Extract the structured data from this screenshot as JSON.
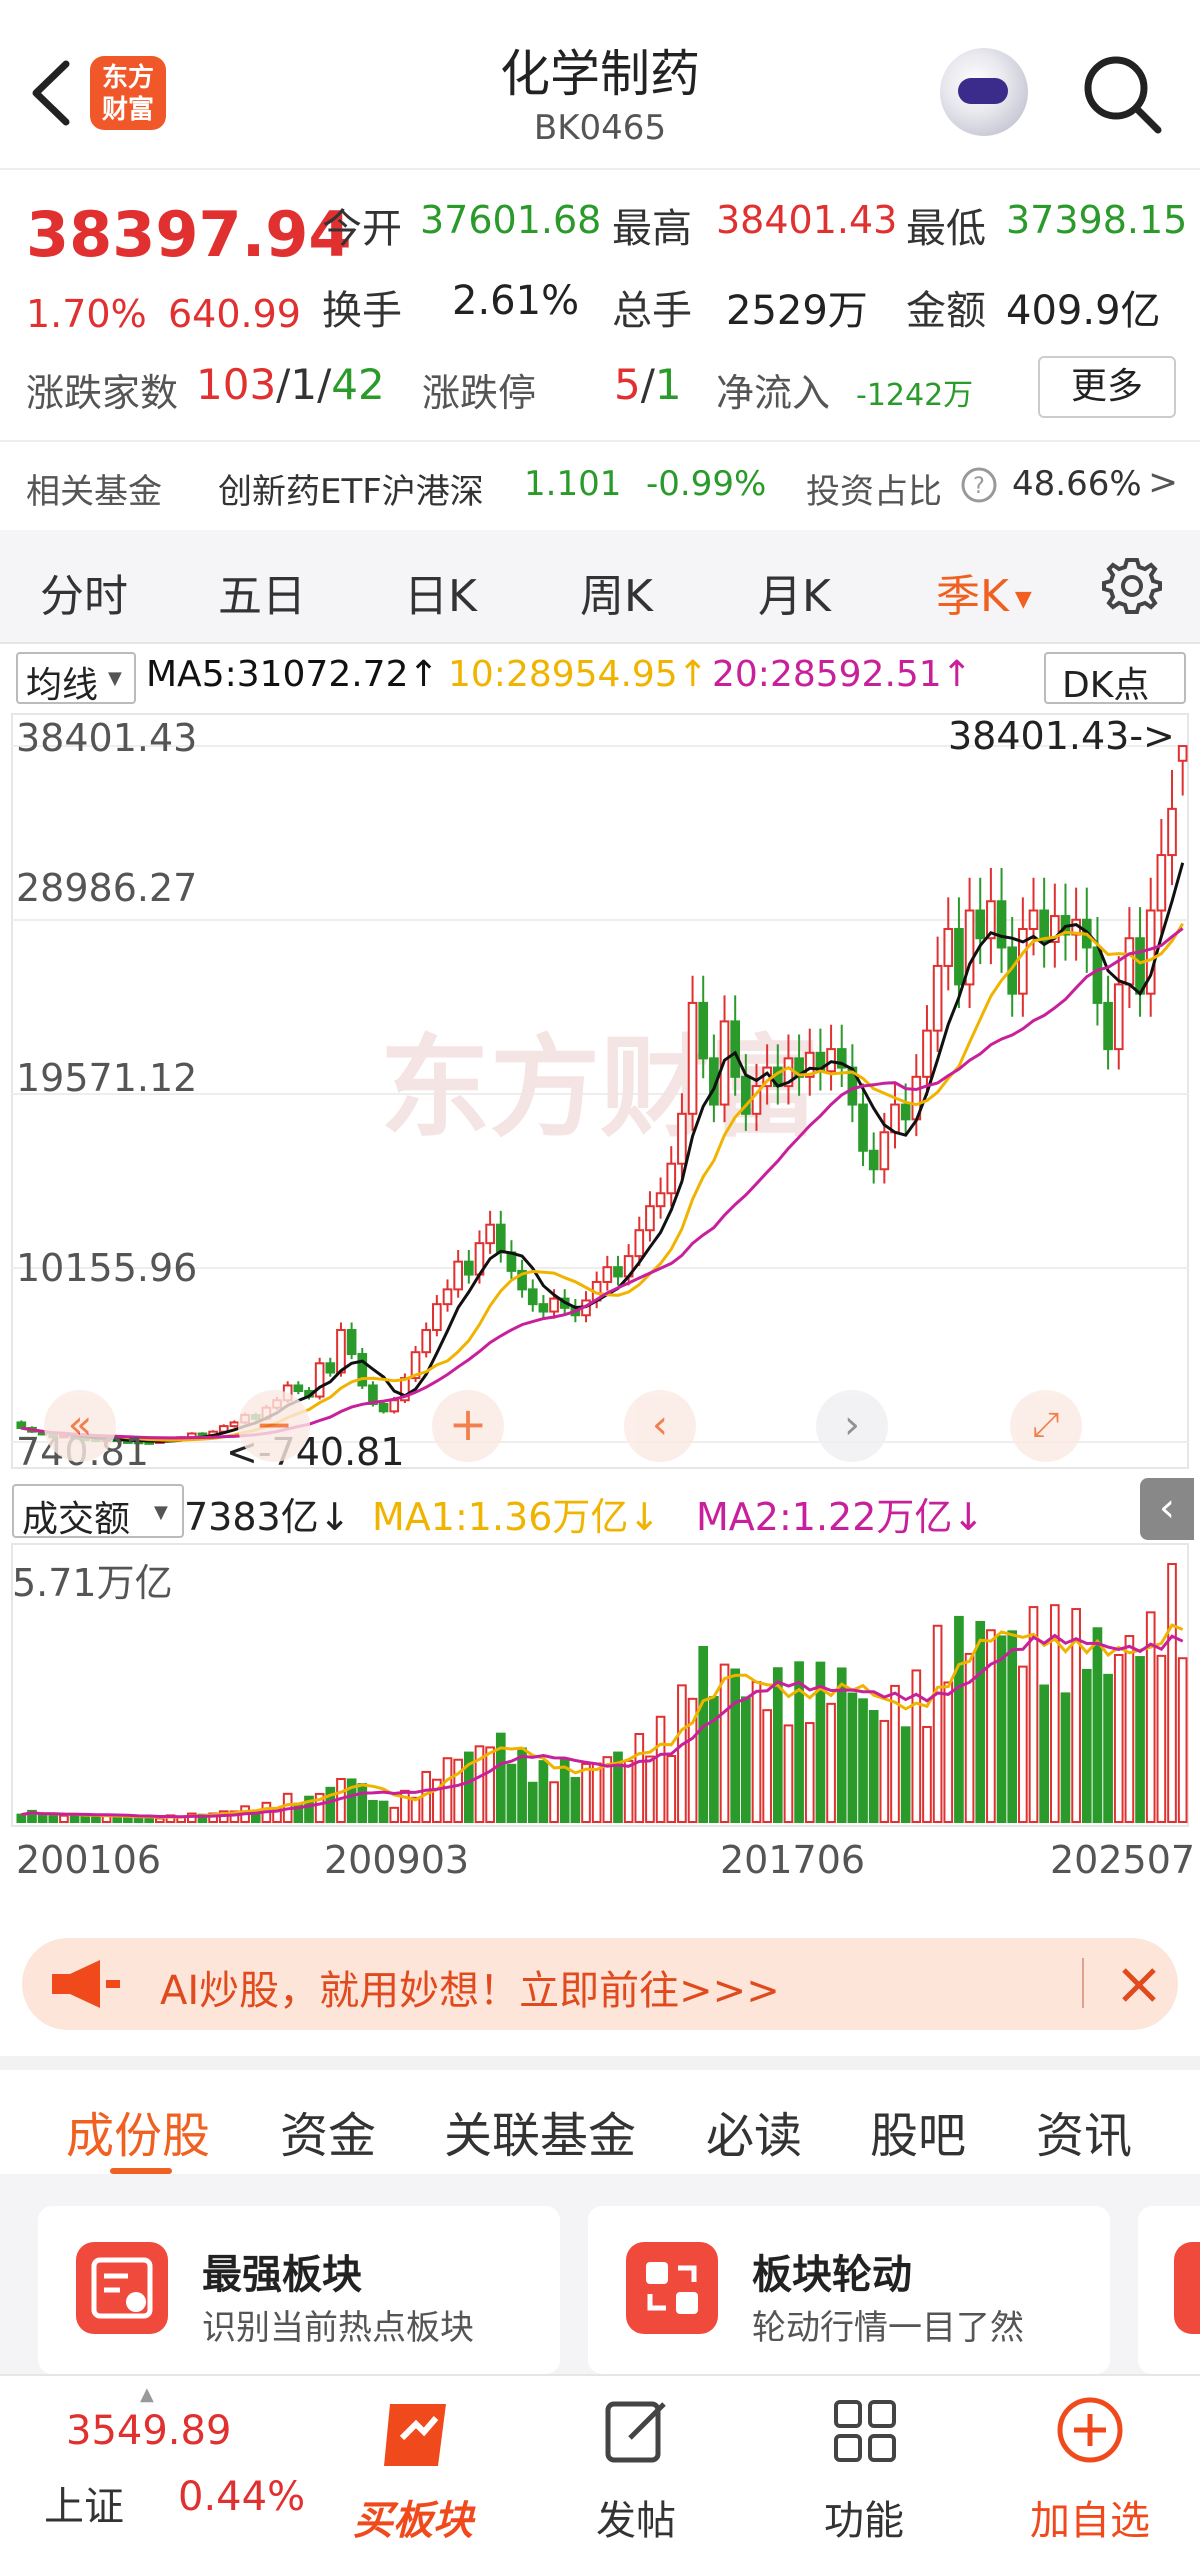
{
  "header": {
    "title": "化学制药",
    "code": "BK0465",
    "logo_text": "东方财富",
    "icons": [
      "back-arrow-icon",
      "robot-assistant-icon",
      "search-icon"
    ]
  },
  "quote": {
    "price": "38397.94",
    "change_pct": "1.70%",
    "change_abs": "640.99",
    "open_label": "今开",
    "open": "37601.68",
    "high_label": "最高",
    "high": "38401.43",
    "low_label": "最低",
    "low": "37398.15",
    "turnover_label": "换手",
    "turnover": "2.61%",
    "volume_label": "总手",
    "volume": "2529万",
    "amount_label": "金额",
    "amount": "409.9亿",
    "updown_label": "涨跌家数",
    "up": "103",
    "flat": "1",
    "down": "42",
    "limit_label": "涨跌停",
    "limit_up": "5",
    "limit_down": "1",
    "netflow_label": "净流入",
    "netflow": "-1242万",
    "more_label": "更多",
    "sep": "/"
  },
  "fund": {
    "label": "相关基金",
    "name": "创新药ETF沪港深",
    "price": "1.101",
    "pct": "-0.99%",
    "ratio_label": "投资占比",
    "ratio": "48.66%",
    "arrow": ">"
  },
  "period_tabs": [
    "分时",
    "五日",
    "日K",
    "周K",
    "月K",
    "季K"
  ],
  "active_period": "季K",
  "ma": {
    "type_label": "均线",
    "ma5": "MA5:31072.72↑",
    "ma10": "10:28954.95↑",
    "ma20": "20:28592.51↑",
    "dk_label": "DK点"
  },
  "kline": {
    "y_labels": [
      "38401.43",
      "28986.27",
      "19571.12",
      "10155.96",
      "740.81"
    ],
    "max_marker": "38401.43->",
    "min_marker": "<-740.81",
    "watermark": "东方财富",
    "controls": [
      "double-left-icon",
      "zoom-out-icon",
      "zoom-in-icon",
      "prev-icon",
      "next-icon",
      "fullscreen-icon"
    ]
  },
  "volume": {
    "type_label": "成交额",
    "value": "7383亿↓",
    "ma1": "MA1:1.36万亿↓",
    "ma2": "MA2:1.22万亿↓",
    "y_max": "5.71万亿",
    "x_labels": [
      "200106",
      "200903",
      "201706",
      "202507"
    ]
  },
  "colors": {
    "up": "#e03030",
    "down": "#2a9a2a",
    "accent": "#f06020",
    "ma5": "#111111",
    "ma10": "#f0b400",
    "ma20": "#c8209a"
  },
  "banner": {
    "text": "AI炒股，就用妙想！立即前往>>>"
  },
  "sub_tabs": [
    "成份股",
    "资金",
    "关联基金",
    "必读",
    "股吧",
    "资讯"
  ],
  "active_sub_tab": "成份股",
  "cards": [
    {
      "title": "最强板块",
      "subtitle": "识别当前热点板块"
    },
    {
      "title": "板块轮动",
      "subtitle": "轮动行情一目了然"
    }
  ],
  "bottom": {
    "index_value": "3549.89",
    "index_name": "上证",
    "index_pct": "0.44%",
    "items": [
      "买板块",
      "发帖",
      "功能",
      "加自选"
    ]
  },
  "chart_data": {
    "type": "candlestick",
    "period": "季K",
    "x_range": [
      "200106",
      "202507"
    ],
    "ylim": [
      740.81,
      38401.43
    ],
    "y_ticks": [
      38401.43,
      28986.27,
      19571.12,
      10155.96,
      740.81
    ],
    "candles": [
      {
        "o": 1800,
        "c": 1500
      },
      {
        "o": 1500,
        "c": 1300
      },
      {
        "o": 1300,
        "c": 1150
      },
      {
        "o": 1150,
        "c": 1000
      },
      {
        "o": 1000,
        "c": 1100
      },
      {
        "o": 1100,
        "c": 950
      },
      {
        "o": 950,
        "c": 900
      },
      {
        "o": 900,
        "c": 850
      },
      {
        "o": 850,
        "c": 900
      },
      {
        "o": 900,
        "c": 800
      },
      {
        "o": 800,
        "c": 780
      },
      {
        "o": 780,
        "c": 750
      },
      {
        "o": 750,
        "c": 741
      },
      {
        "o": 741,
        "c": 800
      },
      {
        "o": 800,
        "c": 900
      },
      {
        "o": 900,
        "c": 1000
      },
      {
        "o": 1000,
        "c": 1200
      },
      {
        "o": 1200,
        "c": 1100
      },
      {
        "o": 1100,
        "c": 1300
      },
      {
        "o": 1300,
        "c": 1600
      },
      {
        "o": 1600,
        "c": 1800
      },
      {
        "o": 1800,
        "c": 2200
      },
      {
        "o": 2200,
        "c": 2000
      },
      {
        "o": 2000,
        "c": 2600
      },
      {
        "o": 2600,
        "c": 3000
      },
      {
        "o": 3000,
        "c": 3800
      },
      {
        "o": 3800,
        "c": 3500
      },
      {
        "o": 3500,
        "c": 3200
      },
      {
        "o": 3200,
        "c": 5000
      },
      {
        "o": 5000,
        "c": 4500
      },
      {
        "o": 4500,
        "c": 6800
      },
      {
        "o": 6800,
        "c": 5500
      },
      {
        "o": 5500,
        "c": 3800
      },
      {
        "o": 3800,
        "c": 2800
      },
      {
        "o": 2800,
        "c": 2400
      },
      {
        "o": 2400,
        "c": 3000
      },
      {
        "o": 3000,
        "c": 4200
      },
      {
        "o": 4200,
        "c": 5600
      },
      {
        "o": 5600,
        "c": 6800
      },
      {
        "o": 6800,
        "c": 8200
      },
      {
        "o": 8200,
        "c": 9000
      },
      {
        "o": 9000,
        "c": 10500
      },
      {
        "o": 10500,
        "c": 9800
      },
      {
        "o": 9800,
        "c": 11500
      },
      {
        "o": 11500,
        "c": 12500
      },
      {
        "o": 12500,
        "c": 11000
      },
      {
        "o": 11000,
        "c": 10000
      },
      {
        "o": 10000,
        "c": 9000
      },
      {
        "o": 9000,
        "c": 8200
      },
      {
        "o": 8200,
        "c": 7800
      },
      {
        "o": 7800,
        "c": 8500
      },
      {
        "o": 8500,
        "c": 8000
      },
      {
        "o": 8000,
        "c": 7600
      },
      {
        "o": 7600,
        "c": 8400
      },
      {
        "o": 8400,
        "c": 9400
      },
      {
        "o": 9400,
        "c": 10200
      },
      {
        "o": 10200,
        "c": 9700
      },
      {
        "o": 9700,
        "c": 10800
      },
      {
        "o": 10800,
        "c": 12200
      },
      {
        "o": 12200,
        "c": 13500
      },
      {
        "o": 13500,
        "c": 14200
      },
      {
        "o": 14200,
        "c": 15800
      },
      {
        "o": 15800,
        "c": 18500
      },
      {
        "o": 18500,
        "c": 24500
      },
      {
        "o": 24500,
        "c": 21500
      },
      {
        "o": 21500,
        "c": 19000
      },
      {
        "o": 19000,
        "c": 23500
      },
      {
        "o": 23500,
        "c": 20500
      },
      {
        "o": 20500,
        "c": 18500
      },
      {
        "o": 18500,
        "c": 20000
      },
      {
        "o": 20000,
        "c": 21000
      },
      {
        "o": 21000,
        "c": 20000
      },
      {
        "o": 20000,
        "c": 21500
      },
      {
        "o": 21500,
        "c": 20500
      },
      {
        "o": 20500,
        "c": 21800
      },
      {
        "o": 21800,
        "c": 20800
      },
      {
        "o": 20800,
        "c": 22000
      },
      {
        "o": 22000,
        "c": 21000
      },
      {
        "o": 21000,
        "c": 19000
      },
      {
        "o": 19000,
        "c": 16500
      },
      {
        "o": 16500,
        "c": 15500
      },
      {
        "o": 15500,
        "c": 17500
      },
      {
        "o": 17500,
        "c": 19000
      },
      {
        "o": 19000,
        "c": 18200
      },
      {
        "o": 18200,
        "c": 20500
      },
      {
        "o": 20500,
        "c": 23000
      },
      {
        "o": 23000,
        "c": 26500
      },
      {
        "o": 26500,
        "c": 28500
      },
      {
        "o": 28500,
        "c": 25500
      },
      {
        "o": 25500,
        "c": 29500
      },
      {
        "o": 29500,
        "c": 28000
      },
      {
        "o": 28000,
        "c": 30000
      },
      {
        "o": 30000,
        "c": 27500
      },
      {
        "o": 27500,
        "c": 25000
      },
      {
        "o": 25000,
        "c": 28500
      },
      {
        "o": 28500,
        "c": 29500
      },
      {
        "o": 29500,
        "c": 27800
      },
      {
        "o": 27800,
        "c": 29200
      },
      {
        "o": 29200,
        "c": 28200
      },
      {
        "o": 28200,
        "c": 29000
      },
      {
        "o": 29000,
        "c": 27500
      },
      {
        "o": 27500,
        "c": 24500
      },
      {
        "o": 24500,
        "c": 22000
      },
      {
        "o": 22000,
        "c": 25500
      },
      {
        "o": 25500,
        "c": 28000
      },
      {
        "o": 28000,
        "c": 25000
      },
      {
        "o": 25000,
        "c": 29500
      },
      {
        "o": 29500,
        "c": 32500
      },
      {
        "o": 32500,
        "c": 35000
      },
      {
        "o": 37601.68,
        "c": 38397.94
      }
    ],
    "series": [
      {
        "name": "MA5",
        "last": 31072.72
      },
      {
        "name": "10",
        "last": 28954.95
      },
      {
        "name": "20",
        "last": 28592.51
      }
    ],
    "volume_ylim_label": "5.71万亿"
  }
}
